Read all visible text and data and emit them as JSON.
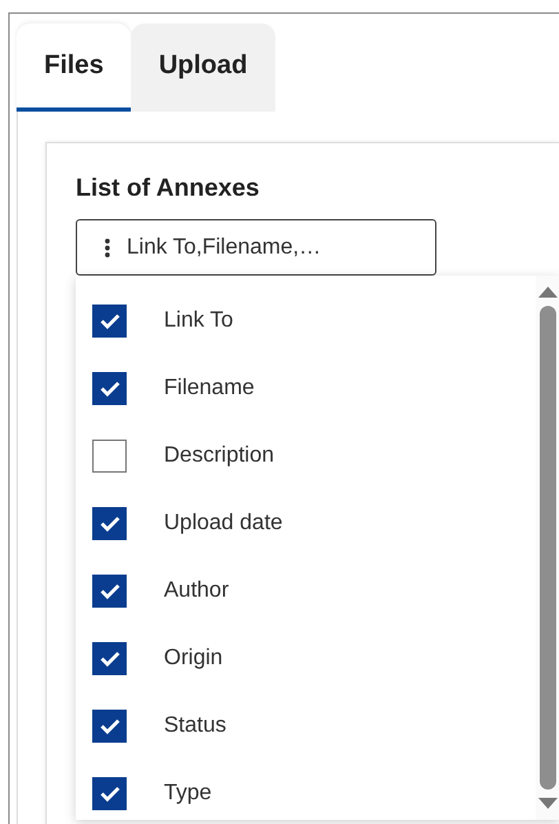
{
  "tabs": [
    {
      "label": "Files",
      "selected": true
    },
    {
      "label": "Upload",
      "selected": false
    }
  ],
  "card": {
    "title": "List of Annexes",
    "column_picker": {
      "value": "Link To,Filename,…"
    }
  },
  "columns_menu": [
    {
      "label": "Link To",
      "checked": true
    },
    {
      "label": "Filename",
      "checked": true
    },
    {
      "label": "Description",
      "checked": false
    },
    {
      "label": "Upload date",
      "checked": true
    },
    {
      "label": "Author",
      "checked": true
    },
    {
      "label": "Origin",
      "checked": true
    },
    {
      "label": "Status",
      "checked": true
    },
    {
      "label": "Type",
      "checked": true
    }
  ]
}
